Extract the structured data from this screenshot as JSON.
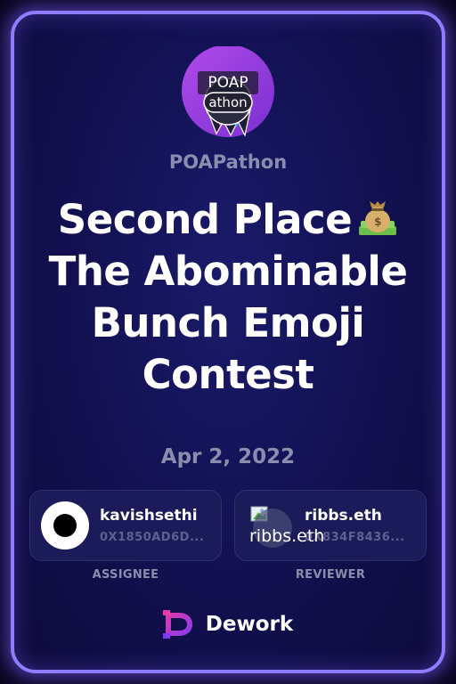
{
  "org": {
    "name": "POAPathon",
    "logo_text_top": "POAP",
    "logo_text_bottom": "athon"
  },
  "title_lines": [
    "Second Place",
    "The Abominable",
    "Bunch Emoji",
    "Contest"
  ],
  "title_emoji": "money-bag-icon",
  "date": "Apr 2, 2022",
  "assignee": {
    "name": "kavishsethi",
    "address": "0X1850AD6D...",
    "role": "ASSIGNEE"
  },
  "reviewer": {
    "name": "ribbs.eth",
    "address": "0X834F8436...",
    "avatar_alt": "ribbs.eth",
    "role": "REVIEWER"
  },
  "brand": {
    "name": "Dework"
  },
  "colors": {
    "border": "#8f7dff",
    "background": "#12104f",
    "muted_text": "#8a8dad",
    "panel": "#1a1b58",
    "logo_pink": "#e83aa8",
    "logo_purple": "#7d3cf0"
  }
}
